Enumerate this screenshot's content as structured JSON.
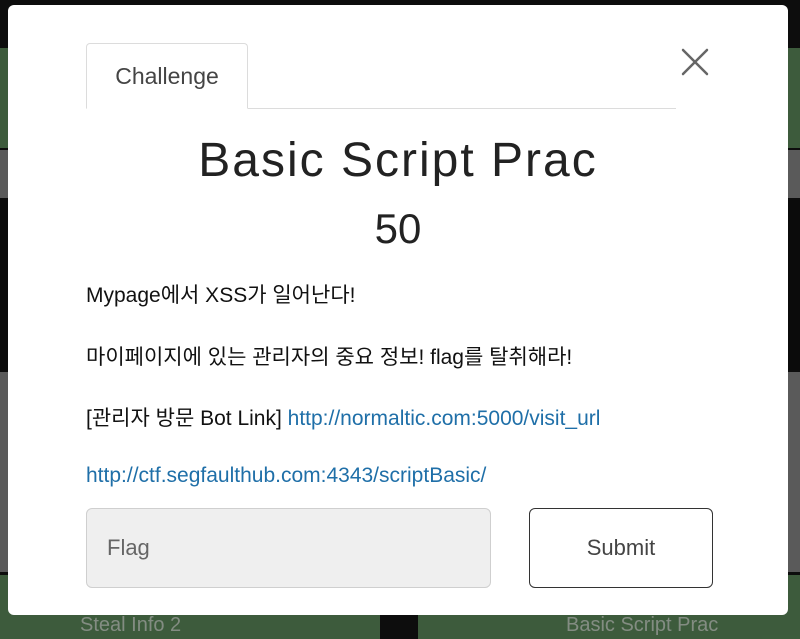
{
  "background": {
    "card_labels": [
      "Steal Info 2",
      "Basic Script Prac"
    ]
  },
  "modal": {
    "tab_label": "Challenge",
    "title": "Basic Script Prac",
    "points": "50",
    "description": {
      "line1": "Mypage에서 XSS가 일어난다!",
      "line2": "마이페이지에 있는 관리자의 중요 정보! flag를 탈취해라!",
      "line3_prefix": "[관리자 방문 Bot Link] ",
      "line3_link": "http://normaltic.com:5000/visit_url",
      "line4_link": "http://ctf.segfaulthub.com:4343/scriptBasic/"
    },
    "flag_placeholder": "Flag",
    "submit_label": "Submit"
  },
  "colors": {
    "link": "#1f6fa8",
    "bg_card_green": "#5e8d5c"
  }
}
